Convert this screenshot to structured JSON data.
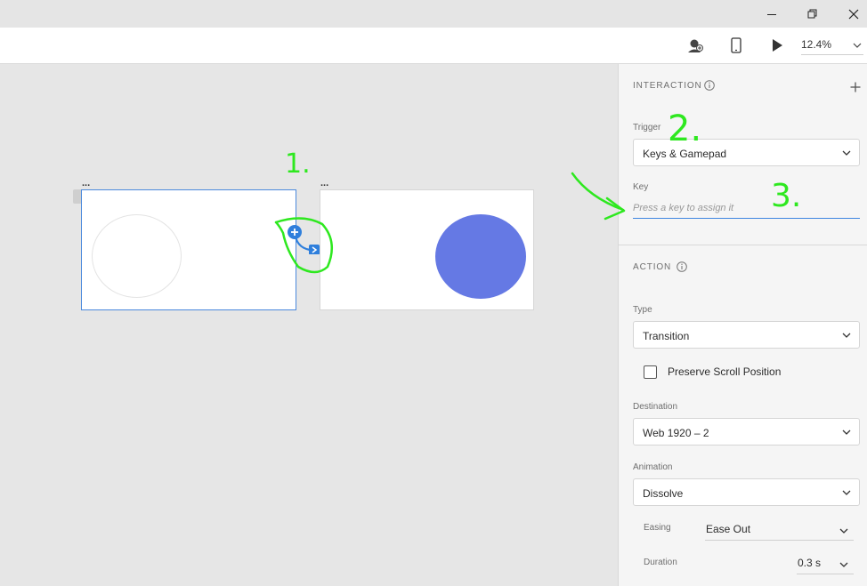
{
  "toolbar": {
    "zoom_value": "12.4%"
  },
  "canvas": {
    "artboard1_label": "...",
    "artboard2_label": "...",
    "accent_color": "#4b89dc",
    "circle_fill": "#6579e4"
  },
  "annotations": {
    "marker_1": "1.",
    "marker_2": "2.",
    "marker_3": "3.",
    "color": "#2ee81f"
  },
  "panel": {
    "interaction_title": "INTERACTION",
    "trigger_label": "Trigger",
    "trigger_value": "Keys & Gamepad",
    "key_label": "Key",
    "key_placeholder": "Press a key to assign it",
    "action_title": "ACTION",
    "type_label": "Type",
    "type_value": "Transition",
    "preserve_scroll_label": "Preserve Scroll Position",
    "destination_label": "Destination",
    "destination_value": "Web 1920 – 2",
    "animation_label": "Animation",
    "animation_value": "Dissolve",
    "easing_label": "Easing",
    "easing_value": "Ease Out",
    "duration_label": "Duration",
    "duration_value": "0.3 s"
  }
}
